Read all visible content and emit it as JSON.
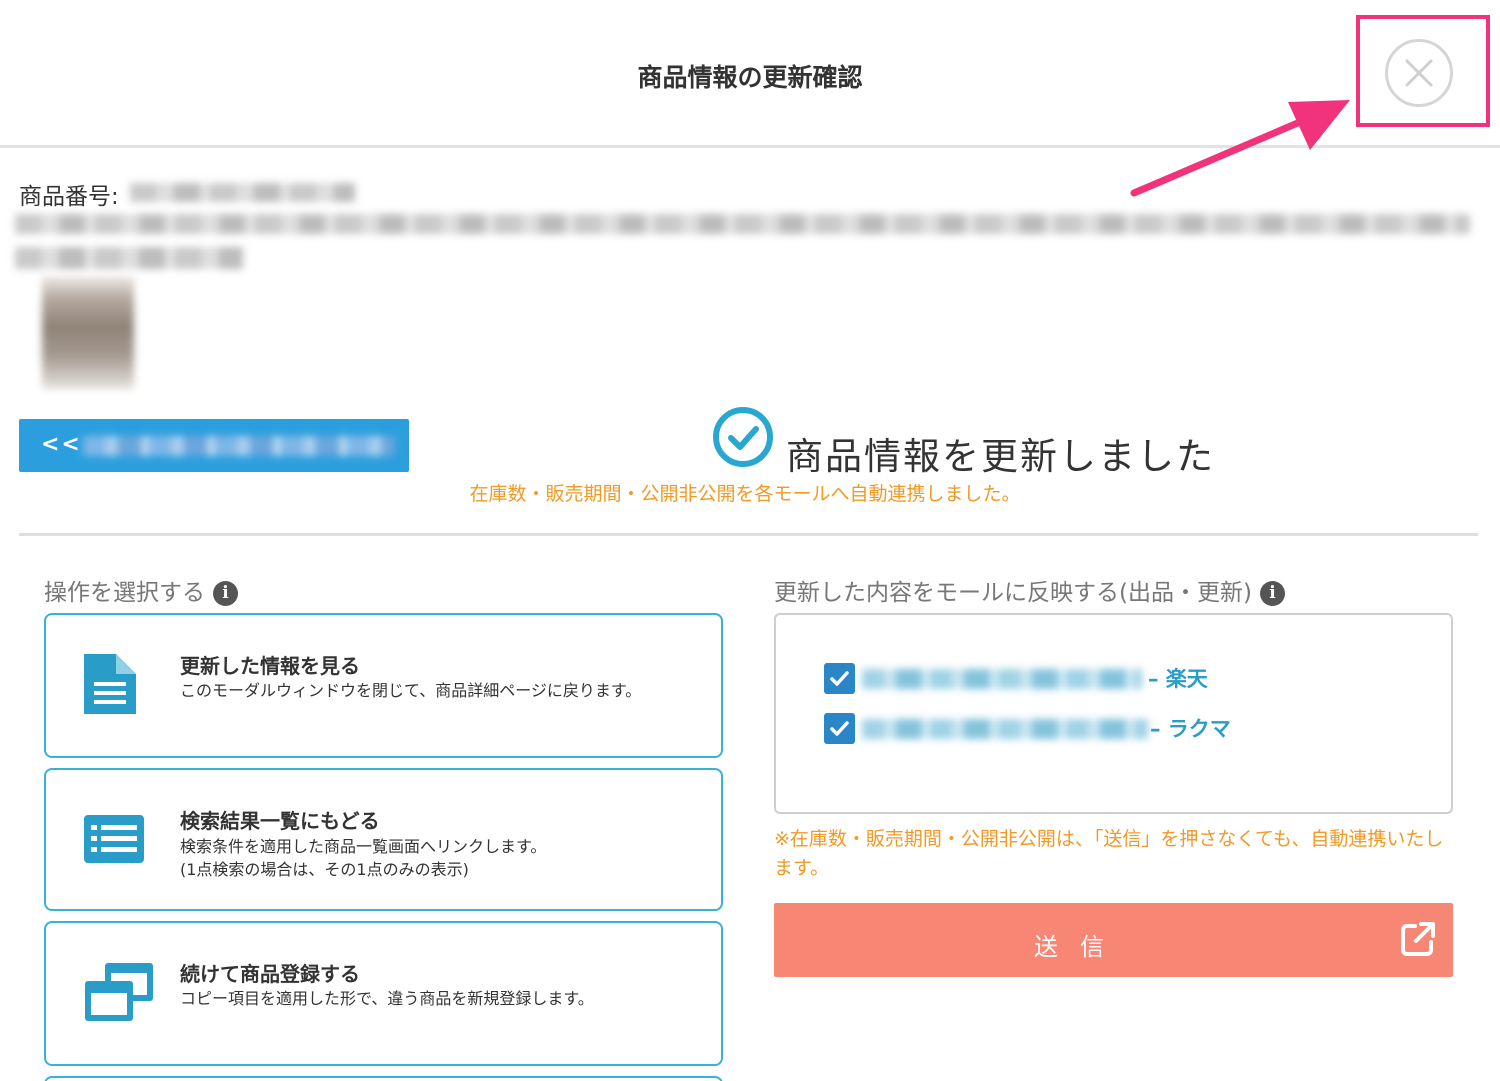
{
  "modal": {
    "title": "商品情報の更新確認"
  },
  "product": {
    "number_label": "商品番号:"
  },
  "back_button": {
    "arrow": "<<"
  },
  "result": {
    "title": "商品情報を更新しました",
    "subtitle": "在庫数・販売期間・公開非公開を各モールへ自動連携しました。"
  },
  "actions": {
    "section_label": "操作を選択する",
    "info_icon": "i",
    "cards": [
      {
        "icon": "document-icon",
        "title": "更新した情報を見る",
        "description": "このモーダルウィンドウを閉じて、商品詳細ページに戻ります。"
      },
      {
        "icon": "list-icon",
        "title": "検索結果一覧にもどる",
        "description": "検索条件を適用した商品一覧画面へリンクします。",
        "description2": "(1点検索の場合は、その1点のみの表示)"
      },
      {
        "icon": "windows-icon",
        "title": "続けて商品登録する",
        "description": "コピー項目を適用した形で、違う商品を新規登録します。"
      }
    ]
  },
  "mall_sync": {
    "section_label": "更新した内容をモールに反映する(出品・更新)",
    "info_icon": "i",
    "malls": [
      {
        "name": "– 楽天",
        "checked": true
      },
      {
        "name": "– ラクマ",
        "checked": true
      }
    ],
    "note": "※在庫数・販売期間・公開非公開は、「送信」を押さなくても、自動連携いたします。",
    "send_label": "送信"
  },
  "colors": {
    "accent_blue": "#2b9fde",
    "card_border": "#38b2d6",
    "success_teal": "#2aa7d0",
    "warning_orange": "#f19a25",
    "send_button": "#f88674",
    "highlight_pink": "#f0337a"
  }
}
